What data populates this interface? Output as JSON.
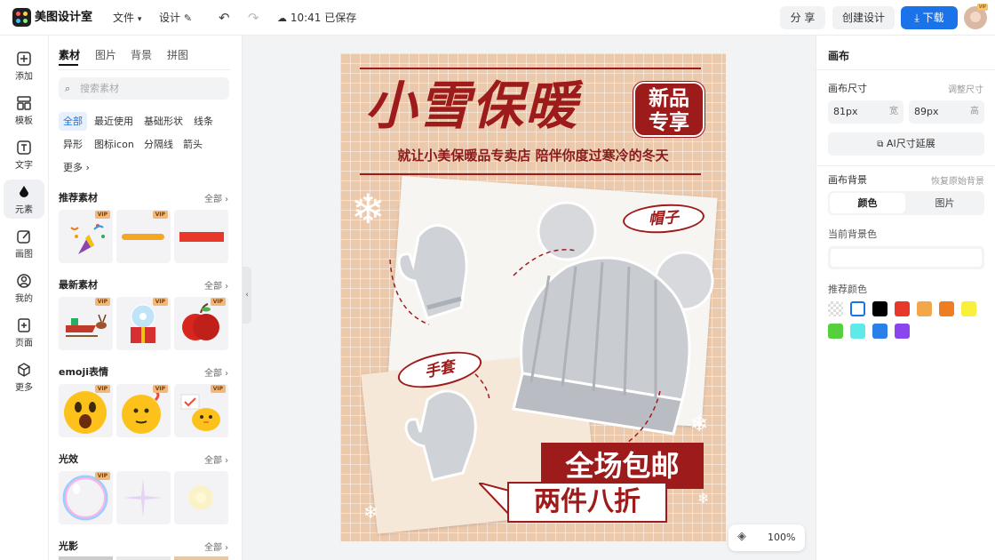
{
  "app": {
    "name": "美图设计室"
  },
  "topbar": {
    "file_menu": "文件",
    "design_menu": "设计",
    "save_status": "10:41 已保存",
    "share_label": "分 享",
    "create_label": "创建设计",
    "download_label": "下载",
    "avatar_badge": "VIP"
  },
  "leftnav": {
    "items": [
      {
        "label": "添加",
        "icon": "plus-square-icon"
      },
      {
        "label": "模板",
        "icon": "template-icon"
      },
      {
        "label": "文字",
        "icon": "text-icon"
      },
      {
        "label": "元素",
        "icon": "element-icon"
      },
      {
        "label": "画图",
        "icon": "draw-icon"
      },
      {
        "label": "我的",
        "icon": "user-icon"
      },
      {
        "label": "页面",
        "icon": "page-icon"
      },
      {
        "label": "更多",
        "icon": "cube-icon"
      }
    ]
  },
  "panel": {
    "tabs": [
      "素材",
      "图片",
      "背景",
      "拼图"
    ],
    "search_placeholder": "搜索素材",
    "chips": [
      "全部",
      "最近使用",
      "基础形状",
      "线条",
      "异形",
      "图标icon",
      "分隔线",
      "箭头",
      "更多"
    ],
    "sections": [
      {
        "title": "推荐素材",
        "all": "全部"
      },
      {
        "title": "最新素材",
        "all": "全部"
      },
      {
        "title": "emoji表情",
        "all": "全部"
      },
      {
        "title": "光效",
        "all": "全部"
      },
      {
        "title": "光影",
        "all": "全部"
      }
    ],
    "vip": "VIP"
  },
  "poster": {
    "title": "小雪保暖",
    "badge_line1": "新品",
    "badge_line2": "专享",
    "subtitle": "就让小美保暖品专卖店 陪伴你度过寒冷的冬天",
    "tag_hat": "帽子",
    "tag_gloves": "手套",
    "promo1": "全场包邮",
    "promo2": "两件八折"
  },
  "rightpanel": {
    "title": "画布",
    "size_label": "画布尺寸",
    "size_adjust": "调整尺寸",
    "width_value": "81px",
    "width_unit": "宽",
    "height_value": "89px",
    "height_unit": "高",
    "ai_extend": "AI尺寸延展",
    "bg_label": "画布背景",
    "bg_restore": "恢复原始背景",
    "bg_tab_color": "颜色",
    "bg_tab_image": "图片",
    "current_bg": "当前背景色",
    "recommended": "推荐颜色",
    "swatches": [
      "transparent",
      "#ffffff",
      "#000000",
      "#e8382b",
      "#f2a74a",
      "#ef7d22",
      "#f8f03a",
      "#56cf3f",
      "#5eeae8",
      "#2b7fe9",
      "#8a45ef"
    ]
  },
  "zoom": {
    "value": "100%"
  }
}
